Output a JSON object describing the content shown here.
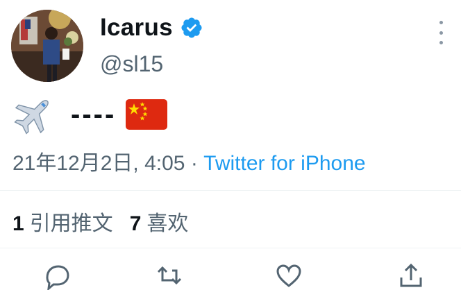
{
  "user": {
    "display_name": "Icarus",
    "handle": "@sl15",
    "verified": true
  },
  "tweet": {
    "emoji_plane": "airplane-emoji",
    "text": "----",
    "emoji_flag": "china-flag-emoji"
  },
  "meta": {
    "date": "21年12月2日, 4:05",
    "separator": " · ",
    "source": "Twitter for iPhone"
  },
  "stats": {
    "quotes_count": "1",
    "quotes_label": "引用推文",
    "likes_count": "7",
    "likes_label": "喜欢"
  },
  "actions": [
    "reply-icon",
    "retweet-icon",
    "like-icon",
    "share-icon"
  ],
  "colors": {
    "link": "#1d9bf0",
    "secondary_text": "#536471",
    "primary_text": "#0f1419"
  }
}
